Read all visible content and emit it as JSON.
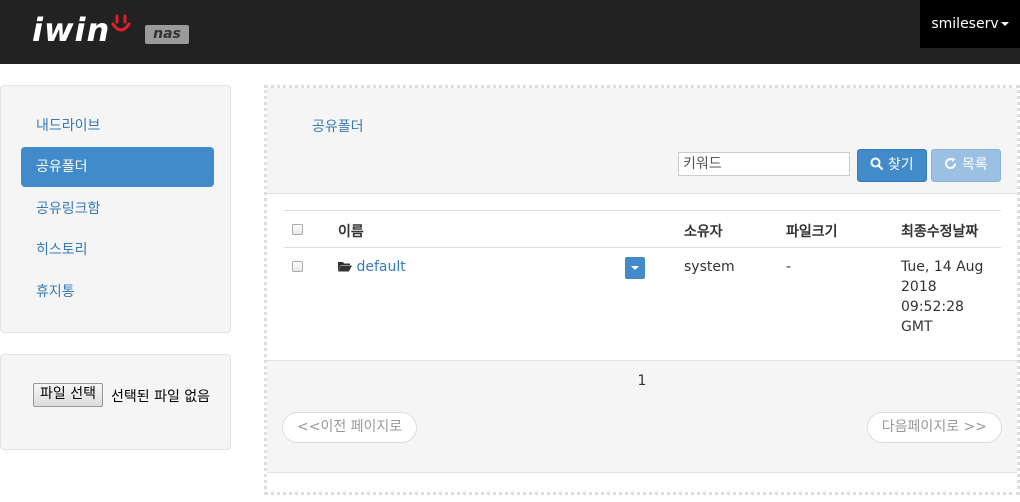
{
  "header": {
    "logo_text": "iwin",
    "badge": "nas",
    "user": "smileserv"
  },
  "sidebar": {
    "items": [
      {
        "label": "내드라이브",
        "active": false
      },
      {
        "label": "공유폴더",
        "active": true
      },
      {
        "label": "공유링크함",
        "active": false
      },
      {
        "label": "히스토리",
        "active": false
      },
      {
        "label": "휴지통",
        "active": false
      }
    ]
  },
  "upload": {
    "button_label": "파일 선택",
    "status": "선택된 파일 없음"
  },
  "main": {
    "breadcrumb": "공유폴더",
    "search": {
      "placeholder": "키워드",
      "search_label": "찾기",
      "list_label": "목록"
    },
    "table": {
      "columns": [
        "이름",
        "소유자",
        "파일크기",
        "최종수정날짜"
      ],
      "rows": [
        {
          "name": "default",
          "owner": "system",
          "size": "-",
          "modified_line1": "Tue, 14 Aug",
          "modified_line2": "2018 09:52:28",
          "modified_line3": "GMT"
        }
      ]
    },
    "pagination": {
      "current_page": "1",
      "prev_label": "<<이전 페이지로",
      "next_label": "다음페이지로 >>"
    }
  },
  "colors": {
    "primary": "#428bca",
    "header_bg": "#222222",
    "link": "#337ab7"
  }
}
